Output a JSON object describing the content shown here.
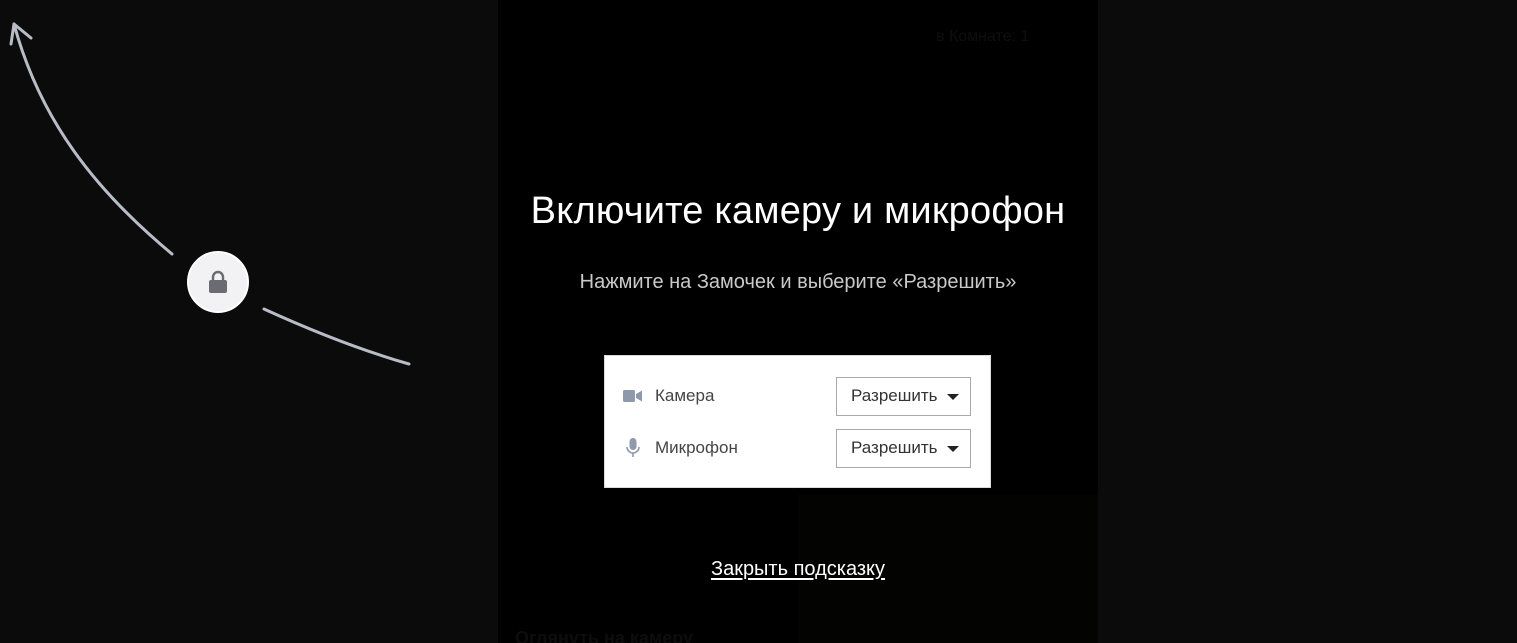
{
  "background": {
    "top_text": "в Комнате: 1",
    "bottom_text": "Оглянуть на камеру"
  },
  "hint": {
    "title": "Включите камеру и микрофон",
    "subtitle": "Нажмите на Замочек и выберите «Разрешить»",
    "close_label": "Закрыть подсказку"
  },
  "permissions": [
    {
      "icon": "video-camera-icon",
      "label": "Камера",
      "value": "Разрешить"
    },
    {
      "icon": "microphone-icon",
      "label": "Микрофон",
      "value": "Разрешить"
    }
  ],
  "lock": {
    "icon": "lock-icon"
  },
  "colors": {
    "page_background": "#0b0b0b",
    "video_background": "#000000",
    "arrow": "#b8bcc6",
    "lock_circle": "#f2f2f4",
    "lock_glyph": "#6b6b72",
    "perm_icon": "#8e9aab",
    "title_text": "#ffffff",
    "subtitle_text": "#c9c9c9"
  }
}
